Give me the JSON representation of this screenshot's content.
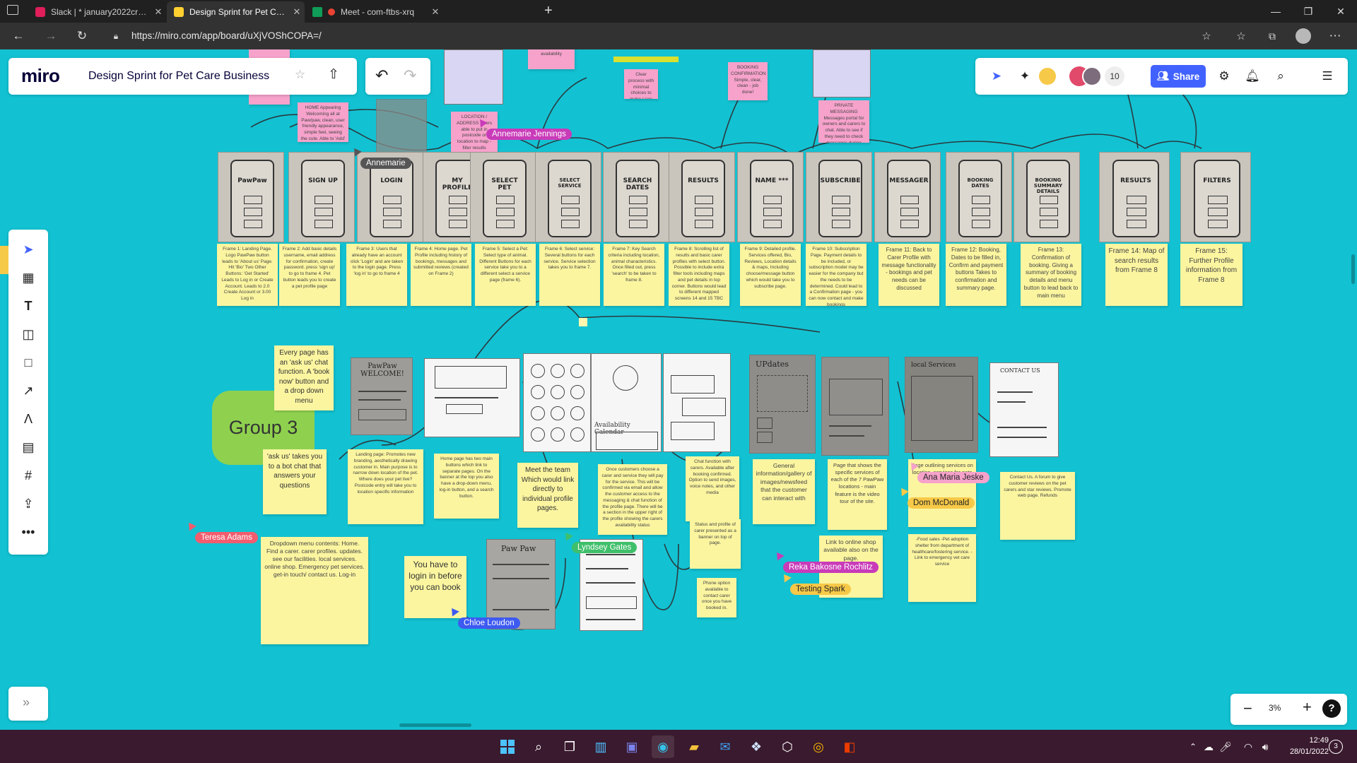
{
  "browser": {
    "tabs": [
      {
        "label": "Slack | * january2022creative-co",
        "icon": "slack-icon",
        "color": "#e01e5a"
      },
      {
        "label": "Design Sprint for Pet Care Busine",
        "icon": "miro-icon",
        "color": "#ffd02f"
      },
      {
        "label": "Meet - com-ftbs-xrq",
        "icon": "meet-icon",
        "color": "#ea4335"
      }
    ],
    "new_tab": "+",
    "url": "https://miro.com/app/board/uXjVOShCOPA=/"
  },
  "miro": {
    "logo": "miro",
    "board_title": "Design Sprint for Pet Care Business",
    "collaborator_count": "10",
    "share_label": "Share",
    "zoom": "3%",
    "help": "?",
    "expand": "»"
  },
  "board": {
    "top_stickies": [
      {
        "text": "browse dates / availability",
        "pink": true
      },
      {
        "text": "BOOKING CONFIRMATION Simple, clear, clean - job done!",
        "pink": true
      },
      {
        "text": "HOME Appearing Welcoming all at Paw/paw, clean, user friendly appearance, simple feel, seeing the cute. Able to 'Add' button on the top-bar and banner for booking",
        "pink": true
      },
      {
        "text": "LOCATION / ADDRESS Users able to put in postcode or location to map - filter results according to distance/ list of requirements",
        "pink": true
      },
      {
        "text": "Clear process with minimal choices to make / see booking available",
        "pink": true
      },
      {
        "text": "PRIVATE MESSAGING Messages portal for owners and carers to chat. Able to see if they need to check messages during bookings",
        "pink": true
      }
    ],
    "frame_titles": [
      "PawPaw",
      "SIGN UP",
      "LOGIN",
      "MY PROFILE",
      "SELECT PET",
      "SELECT SERVICE",
      "SEARCH DATES",
      "RESULTS",
      "NAME ***",
      "SUBSCRIBE",
      "MESSAGER",
      "BOOKING DATES",
      "BOOKING SUMMARY DETAILS",
      "RESULTS",
      "FILTERS"
    ],
    "frame_notes": [
      "Frame 1: Landing Page. Logo PawPaw button leads to 'About us' Page. Hit 'Bio' Two Other Buttons: 'Get Started' Leads to Log in or Create Account. Leads to 2.0 Create Account or 3.00 Log in",
      "Frame 2: Add basic details username, email address for confirmation, create password. press 'sign up' to go to frame 4. Pet button leads you to create a pet profile page",
      "Frame 3: Users that already have an account click 'Login' and are taken to the login page. Press 'log in' to go to frame 4",
      "Frame 4: Home page. Pet Profile including history of bookings, messages and submitted reviews (created on Frame 2)",
      "Frame 5: Select a Pet: Select type of animal. Different Buttons for each service take you to a different select a service page (frame 6).",
      "Frame 6: Select service: Several buttons for each service. Service selection takes you to frame 7.",
      "Frame 7: Key Search criteria including location, animal characteristics. Once filled out, press 'search' to be taken to frame 8.",
      "Frame 8: Scrolling list of results and basic carer profiles with select button. Possible to include extra filter tools including maps and pet details in top corner. Buttons would lead to different mapped screens 14 and 15 TBC",
      "Frame 9: Detailed profile. Services offered, Bio, Reviews, Location details & maps, Including choose/message button which would take you to subscribe page.",
      "Frame 10: Subscription Page. Payment details to be included, or subscription model may be easier for the company but the needs to be determined. Could lead to a Confirmation page - you can now contact and make bookings",
      "Frame 11: Back to Carer Profile with message functionality - bookings and pet needs can be discussed",
      "Frame 12: Booking, Dates to be filled in, Confirm and payment buttons Takes to confirmation and summary page.",
      "Frame 13: Confirmation of booking. Giving a summary of booking details and menu button to lead back to main menu",
      "Frame 14: Map of search results from Frame 8",
      "Frame 15: Further Profile information from Frame 8"
    ],
    "group_label": "Group 3",
    "group3_notes": {
      "ask_us": "Every page has an 'ask us' chat function. A 'book now' button and a drop down menu",
      "ask_us_bot": "'ask us' takes you to a bot chat that answers your questions",
      "landing": "Landing page: Promotes new branding, aesthetically drawing customer in. Main purpose is to narrow down location of the pet. Where does your pet live? Postcode entry will take you to location specific information",
      "home": "Home page has two main buttons which link to separate pages. On the banner at the top you also have a drop-down menu, log-in button, and a search button.",
      "meet_team": "Meet the team Which would link directly to individual profile pages.",
      "carer_profile": "Once customers choose a carer and service they will pay for the service. This will be confirmed via email and allow the customer access to the messaging & chat function of the profile page. There will be a section in the upper right of the profile showing the carers availability status",
      "chat": "Chat function with carers. Available after booking confirmed. Option to send images, voice notes, and other media",
      "status": "Status and profile of carer presented as a banner on top of page.",
      "phone": "Phone option available to contact carer once you have booked in.",
      "updates": "General information/gallery of images/newsfeed that the customer can interact with",
      "locations": "Page that shows the specific services of each of the 7 PawPaw locations - main feature is the video tour of the site.",
      "shop": "Link to online shop available also on the page.",
      "local": "Page outlining services on location. services for pets",
      "contact": "Contact Us. A forum to give customer reviews on the pet carers and star reviews. Promote web page. Refunds",
      "food": "-Food sales -Pet adoption shelter from department of healthcare/fostering service. -Link to emergency vet care service",
      "dropdown": "Dropdown menu contents: Home. Find a carer. carer profiles. updates. see our facilities. local services. online shop. Emergency pet services. get-in touch/ contact us. Log-in",
      "login": "You have to login in before you can book"
    },
    "sketch_texts": {
      "pawpaw_welcome": "PawPaw WELCOME!",
      "availability": "Availability Calendar",
      "updates": "UPdates",
      "local_services": "local Services",
      "contact_us": "CONTACT US",
      "pawpaw_login": "Paw Paw"
    },
    "cursors": [
      {
        "name": "Annemarie Jennings",
        "color": "#c93bb9"
      },
      {
        "name": "Annemarie",
        "color": "#555555"
      },
      {
        "name": "Teresa Adams",
        "color": "#f25c6e"
      },
      {
        "name": "Lyndsey Gates",
        "color": "#3fbf6a"
      },
      {
        "name": "Chloe Loudon",
        "color": "#3d5af1"
      },
      {
        "name": "Reka Bakosne Rochlitz",
        "color": "#c93bb9"
      },
      {
        "name": "Testing Spark",
        "color": "#f7c948"
      },
      {
        "name": "Ana Maria Jeske",
        "color": "#f6a2cb"
      },
      {
        "name": "Dom McDonald",
        "color": "#f7c948"
      }
    ]
  },
  "taskbar": {
    "time": "12:49",
    "date": "28/01/2022",
    "badge": "3"
  },
  "colors": {
    "board_bg": "#12c2d2",
    "sticky_yellow": "#fbf5a0",
    "sticky_pink": "#f6a2cb",
    "miro_blue": "#4262ff",
    "group_green": "#8fd14f"
  }
}
